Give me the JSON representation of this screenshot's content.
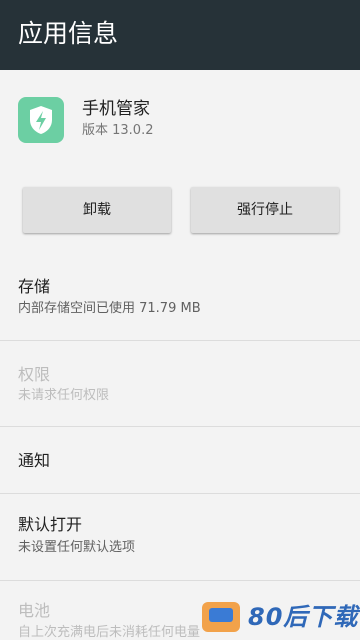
{
  "appbar": {
    "title": "应用信息"
  },
  "app": {
    "name": "手机管家",
    "version": "版本 13.0.2",
    "icon": "shield-bolt-icon",
    "icon_color": "#6ccfa3"
  },
  "actions": {
    "uninstall_label": "卸载",
    "force_stop_label": "强行停止"
  },
  "settings": [
    {
      "title": "存储",
      "subtitle": "内部存储空间已使用 71.79 MB",
      "enabled": true
    },
    {
      "title": "权限",
      "subtitle": "未请求任何权限",
      "enabled": false
    },
    {
      "title": "通知",
      "subtitle": "",
      "enabled": true
    },
    {
      "title": "默认打开",
      "subtitle": "未设置任何默认选项",
      "enabled": true
    },
    {
      "title": "电池",
      "subtitle": "自上次充满电后未消耗任何电量",
      "enabled": false
    }
  ],
  "watermark": {
    "text": "80后下载"
  },
  "colors": {
    "appbar": "#263238",
    "background": "#f3f3f3",
    "button": "#e0e0e0",
    "disabled_text": "#bdbdbd"
  }
}
